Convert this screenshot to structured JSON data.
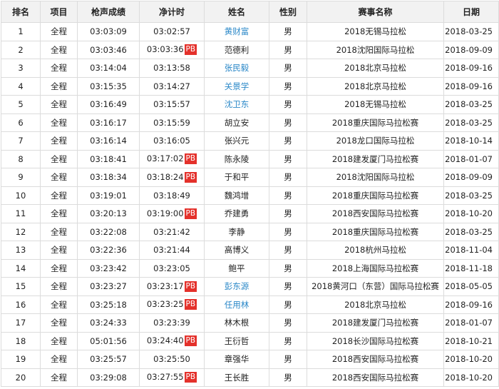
{
  "headers": [
    "排名",
    "项目",
    "枪声成绩",
    "净计时",
    "姓名",
    "性别",
    "赛事名称",
    "日期"
  ],
  "accent_link": "#2b88c8",
  "pb_color": "#e4312b",
  "rows": [
    {
      "rank": "1",
      "event": "全程",
      "gun": "03:03:09",
      "net": "03:02:57",
      "pb": "",
      "name": "黄财富",
      "link": true,
      "gender": "男",
      "race": "2018无锡马拉松",
      "date": "2018-03-25"
    },
    {
      "rank": "2",
      "event": "全程",
      "gun": "03:03:46",
      "net": "03:03:36",
      "pb": "PB",
      "name": "范德利",
      "link": false,
      "gender": "男",
      "race": "2018沈阳国际马拉松",
      "date": "2018-09-09"
    },
    {
      "rank": "3",
      "event": "全程",
      "gun": "03:14:04",
      "net": "03:13:58",
      "pb": "",
      "name": "张民毅",
      "link": true,
      "gender": "男",
      "race": "2018北京马拉松",
      "date": "2018-09-16"
    },
    {
      "rank": "4",
      "event": "全程",
      "gun": "03:15:35",
      "net": "03:14:27",
      "pb": "",
      "name": "关景学",
      "link": true,
      "gender": "男",
      "race": "2018北京马拉松",
      "date": "2018-09-16"
    },
    {
      "rank": "5",
      "event": "全程",
      "gun": "03:16:49",
      "net": "03:15:57",
      "pb": "",
      "name": "沈卫东",
      "link": true,
      "gender": "男",
      "race": "2018无锡马拉松",
      "date": "2018-03-25"
    },
    {
      "rank": "6",
      "event": "全程",
      "gun": "03:16:17",
      "net": "03:15:59",
      "pb": "",
      "name": "胡立安",
      "link": false,
      "gender": "男",
      "race": "2018重庆国际马拉松赛",
      "date": "2018-03-25"
    },
    {
      "rank": "7",
      "event": "全程",
      "gun": "03:16:14",
      "net": "03:16:05",
      "pb": "",
      "name": "张兴元",
      "link": false,
      "gender": "男",
      "race": "2018龙口国际马拉松",
      "date": "2018-10-14"
    },
    {
      "rank": "8",
      "event": "全程",
      "gun": "03:18:41",
      "net": "03:17:02",
      "pb": "PB",
      "name": "陈永陵",
      "link": false,
      "gender": "男",
      "race": "2018建发厦门马拉松赛",
      "date": "2018-01-07"
    },
    {
      "rank": "9",
      "event": "全程",
      "gun": "03:18:34",
      "net": "03:18:24",
      "pb": "PB",
      "name": "于和平",
      "link": false,
      "gender": "男",
      "race": "2018沈阳国际马拉松",
      "date": "2018-09-09"
    },
    {
      "rank": "10",
      "event": "全程",
      "gun": "03:19:01",
      "net": "03:18:49",
      "pb": "",
      "name": "魏鸿增",
      "link": false,
      "gender": "男",
      "race": "2018重庆国际马拉松赛",
      "date": "2018-03-25"
    },
    {
      "rank": "11",
      "event": "全程",
      "gun": "03:20:13",
      "net": "03:19:00",
      "pb": "PB",
      "name": "乔建勇",
      "link": false,
      "gender": "男",
      "race": "2018西安国际马拉松赛",
      "date": "2018-10-20"
    },
    {
      "rank": "12",
      "event": "全程",
      "gun": "03:22:08",
      "net": "03:21:42",
      "pb": "",
      "name": "李静",
      "link": false,
      "gender": "男",
      "race": "2018重庆国际马拉松赛",
      "date": "2018-03-25"
    },
    {
      "rank": "13",
      "event": "全程",
      "gun": "03:22:36",
      "net": "03:21:44",
      "pb": "",
      "name": "高博义",
      "link": false,
      "gender": "男",
      "race": "2018杭州马拉松",
      "date": "2018-11-04"
    },
    {
      "rank": "14",
      "event": "全程",
      "gun": "03:23:42",
      "net": "03:23:05",
      "pb": "",
      "name": "鲍平",
      "link": false,
      "gender": "男",
      "race": "2018上海国际马拉松赛",
      "date": "2018-11-18"
    },
    {
      "rank": "15",
      "event": "全程",
      "gun": "03:23:27",
      "net": "03:23:17",
      "pb": "PB",
      "name": "彭东源",
      "link": true,
      "gender": "男",
      "race": "2018黄河口（东营）国际马拉松赛",
      "date": "2018-05-05"
    },
    {
      "rank": "16",
      "event": "全程",
      "gun": "03:25:18",
      "net": "03:23:25",
      "pb": "PB",
      "name": "任用林",
      "link": true,
      "gender": "男",
      "race": "2018北京马拉松",
      "date": "2018-09-16"
    },
    {
      "rank": "17",
      "event": "全程",
      "gun": "03:24:33",
      "net": "03:23:39",
      "pb": "",
      "name": "林木根",
      "link": false,
      "gender": "男",
      "race": "2018建发厦门马拉松赛",
      "date": "2018-01-07"
    },
    {
      "rank": "18",
      "event": "全程",
      "gun": "05:01:56",
      "net": "03:24:40",
      "pb": "PB",
      "name": "王衍哲",
      "link": false,
      "gender": "男",
      "race": "2018长沙国际马拉松赛",
      "date": "2018-10-21"
    },
    {
      "rank": "19",
      "event": "全程",
      "gun": "03:25:57",
      "net": "03:25:50",
      "pb": "",
      "name": "章强华",
      "link": false,
      "gender": "男",
      "race": "2018西安国际马拉松赛",
      "date": "2018-10-20"
    },
    {
      "rank": "20",
      "event": "全程",
      "gun": "03:29:08",
      "net": "03:27:55",
      "pb": "PB",
      "name": "王长胜",
      "link": false,
      "gender": "男",
      "race": "2018西安国际马拉松赛",
      "date": "2018-10-20"
    }
  ]
}
